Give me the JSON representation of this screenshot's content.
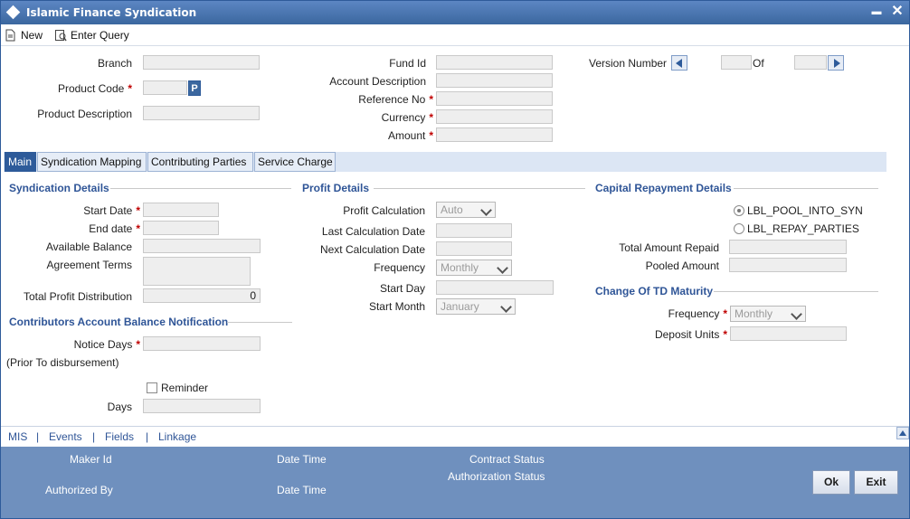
{
  "window": {
    "title": "Islamic Finance Syndication",
    "minimize": "▬",
    "close": "✕"
  },
  "toolbar": {
    "new_label": "New",
    "enter_query_label": "Enter Query"
  },
  "header": {
    "branch_label": "Branch",
    "product_code_label": "Product Code",
    "product_code_lov": "P",
    "product_description_label": "Product Description",
    "fund_id_label": "Fund Id",
    "account_description_label": "Account Description",
    "reference_no_label": "Reference No",
    "currency_label": "Currency",
    "amount_label": "Amount",
    "version_number_label": "Version Number",
    "of_label": "Of",
    "required_mark": "*"
  },
  "tabs": [
    {
      "label": "Main"
    },
    {
      "label": "Syndication Mapping"
    },
    {
      "label": "Contributing Parties"
    },
    {
      "label": "Service Charge"
    }
  ],
  "syndication": {
    "title": "Syndication Details",
    "start_date_label": "Start Date",
    "end_date_label": "End date",
    "available_balance_label": "Available Balance",
    "agreement_terms_label": "Agreement Terms",
    "total_profit_label": "Total Profit Distribution",
    "total_profit_value": "0"
  },
  "contributors": {
    "title": "Contributors Account Balance Notification",
    "notice_days_label": "Notice Days",
    "prior_label": "(Prior To disbursement)",
    "reminder_label": "Reminder",
    "days_label": "Days"
  },
  "profit": {
    "title": "Profit Details",
    "calc_label": "Profit Calculation",
    "calc_value": "Auto",
    "last_calc_label": "Last Calculation Date",
    "next_calc_label": "Next Calculation Date",
    "frequency_label": "Frequency",
    "frequency_value": "Monthly",
    "start_day_label": "Start Day",
    "start_month_label": "Start Month",
    "start_month_value": "January"
  },
  "capital": {
    "title": "Capital Repayment Details",
    "radio_pool": "LBL_POOL_INTO_SYN",
    "radio_repay": "LBL_REPAY_PARTIES",
    "total_repaid_label": "Total Amount Repaid",
    "pooled_label": "Pooled Amount"
  },
  "td_maturity": {
    "title": "Change Of TD Maturity",
    "frequency_label": "Frequency",
    "frequency_value": "Monthly",
    "deposit_units_label": "Deposit Units"
  },
  "links": {
    "mis": "MIS",
    "events": "Events",
    "fields": "Fields",
    "linkage": "Linkage",
    "separator": "|"
  },
  "footer": {
    "maker_id_label": "Maker Id",
    "date_time_label": "Date Time",
    "contract_status_label": "Contract Status",
    "authorization_status_label": "Authorization Status",
    "authorized_by_label": "Authorized By",
    "date_time_label2": "Date Time",
    "ok_label": "Ok",
    "exit_label": "Exit"
  },
  "colors": {
    "title_bar": "#3b679f",
    "tab_active": "#2e5b9a",
    "section_title": "#2f5597",
    "footer": "#6f90be",
    "required": "#c00000"
  }
}
